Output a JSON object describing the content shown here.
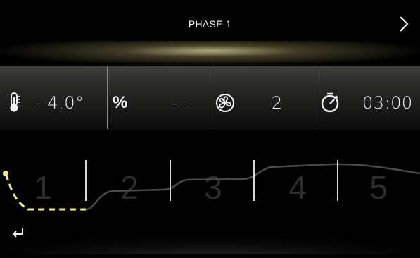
{
  "header": {
    "title": "PHASE 1"
  },
  "params": {
    "temperature": {
      "value": "- 4.0°",
      "icon": "thermometer-icon"
    },
    "humidity": {
      "symbol": "%",
      "value": "---"
    },
    "fan": {
      "value": "2",
      "icon": "fan-icon"
    },
    "timer": {
      "value": "03:00",
      "icon": "stopwatch-icon"
    }
  },
  "phases": {
    "labels": [
      "1",
      "2",
      "3",
      "4",
      "5"
    ],
    "active": "1",
    "colors": {
      "active": "#f2ec9a",
      "curve": "#4a4a4a",
      "marker": "#d8d8d8",
      "label": "#2c2c2c"
    }
  },
  "colors": {
    "accent": "#e7e3a8",
    "background": "#000000"
  }
}
